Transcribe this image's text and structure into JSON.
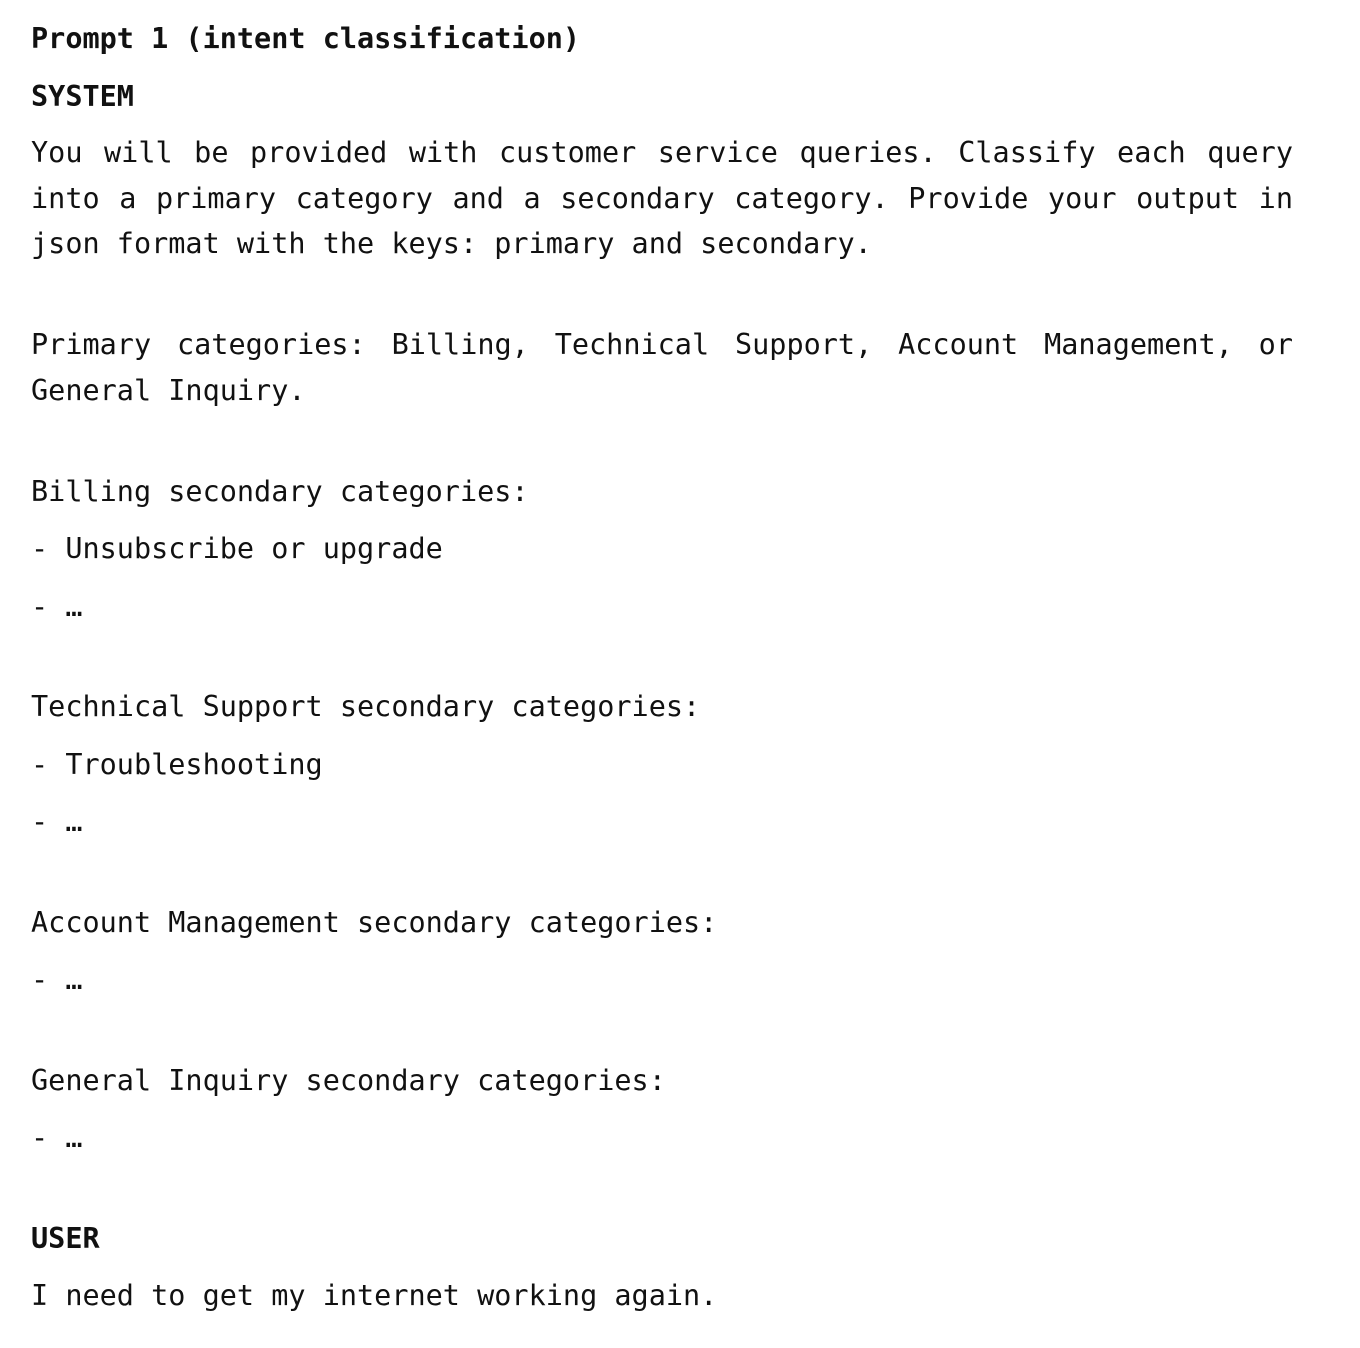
{
  "title": "Prompt 1 (intent classification)",
  "system": {
    "heading": "SYSTEM",
    "intro": "You will be provided with customer service queries. Classify each query into a primary category and a secondary category. Provide your output in json format with the keys: primary and secondary.",
    "primary": "Primary categories: Billing, Technical Support, Account Management, or General Inquiry.",
    "billing": {
      "heading": "Billing secondary categories:",
      "items": [
        "- Unsubscribe or upgrade",
        "- …"
      ]
    },
    "technical": {
      "heading": "Technical Support secondary categories:",
      "items": [
        "- Troubleshooting",
        "- …"
      ]
    },
    "account": {
      "heading": "Account Management secondary categories:",
      "items": [
        "- …"
      ]
    },
    "general": {
      "heading": "General Inquiry secondary categories:",
      "items": [
        "- …"
      ]
    }
  },
  "user": {
    "heading": "USER",
    "message": "I need to get my internet working again."
  }
}
